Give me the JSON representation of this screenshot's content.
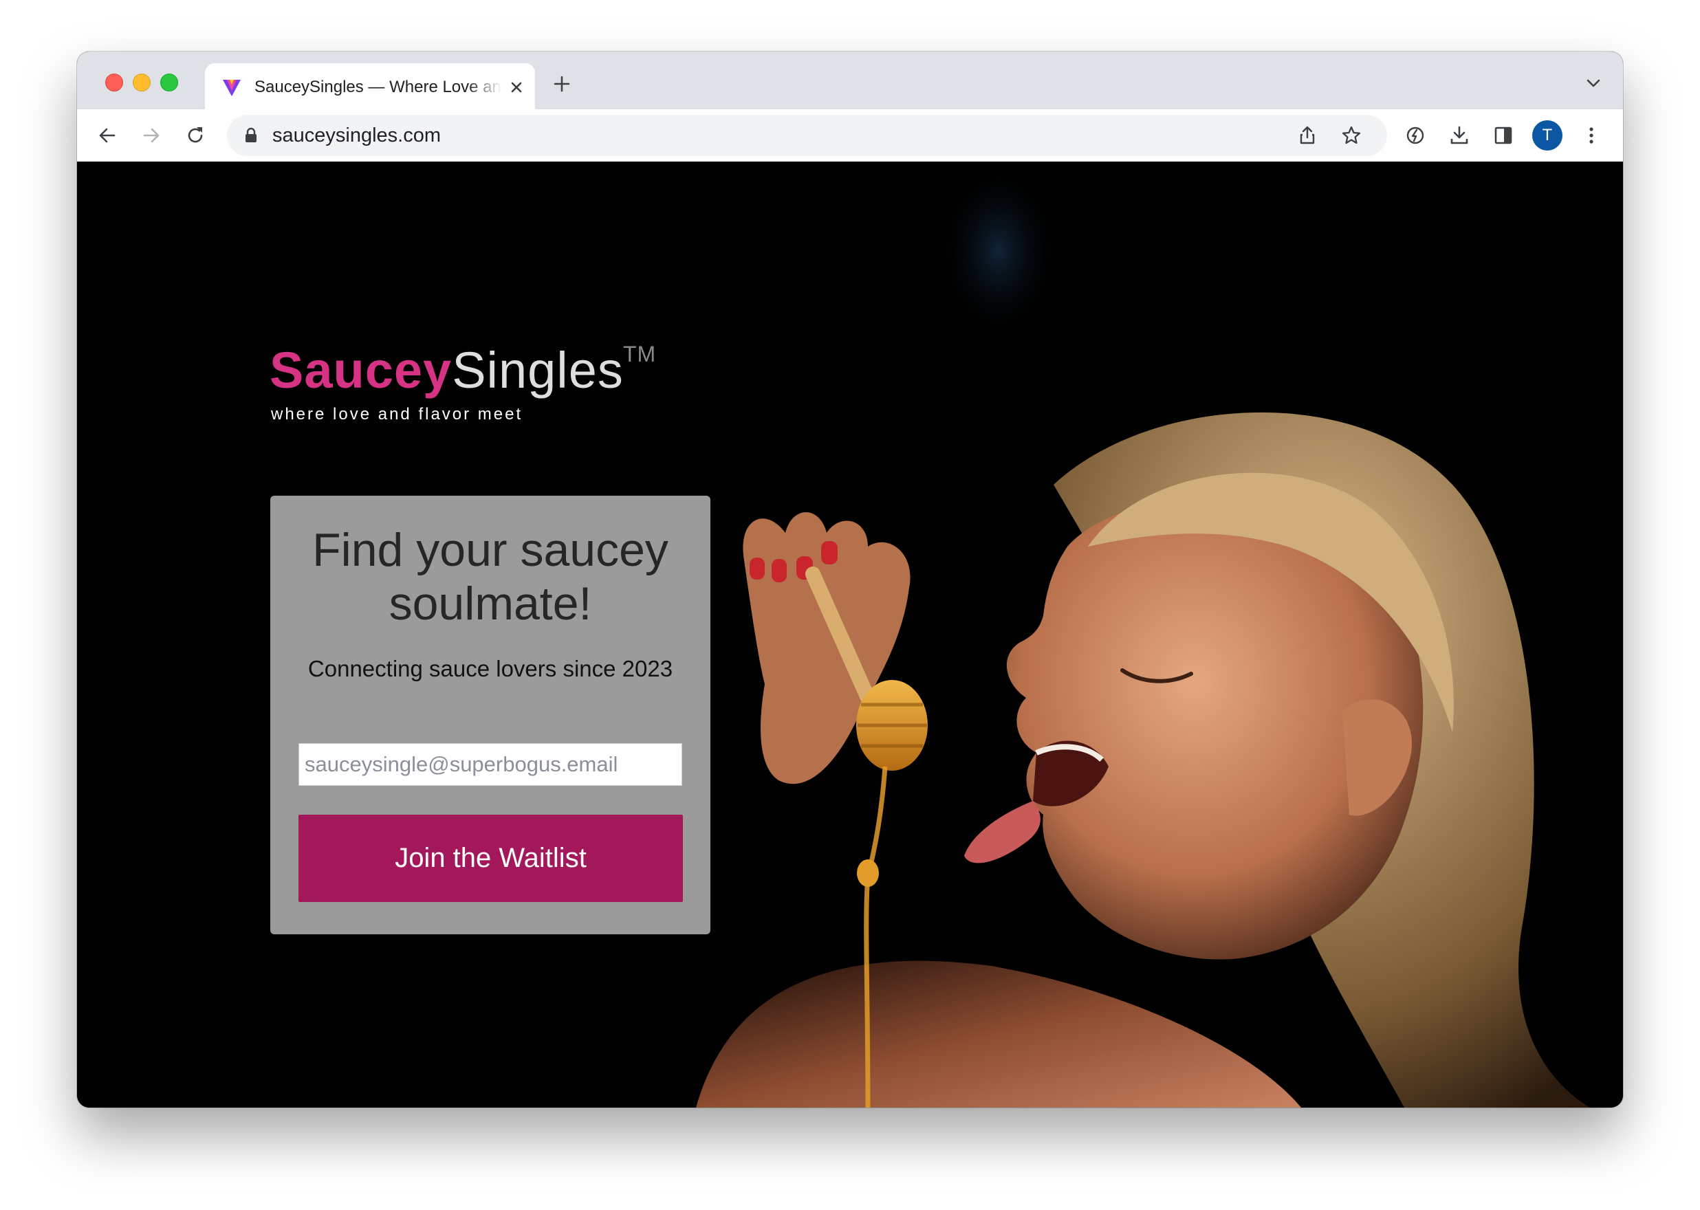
{
  "browser": {
    "tab_title": "SauceySingles — Where Love and Flavor Meet",
    "url": "sauceysingles.com",
    "avatar_initial": "T"
  },
  "hero": {
    "brand_primary": "Saucey",
    "brand_secondary": "Singles",
    "trademark": "TM",
    "tagline": "where love and flavor meet"
  },
  "signup": {
    "headline_line1": "Find your saucey",
    "headline_line2": "soulmate!",
    "subheadline": "Connecting sauce lovers since 2023",
    "email_placeholder": "sauceysingle@superbogus.email",
    "cta_label": "Join the Waitlist"
  },
  "colors": {
    "brand_pink": "#d63384",
    "cta_background": "#a3185a",
    "card_background": "#acacac",
    "avatar": "#0b57a4"
  },
  "icons": [
    "back-arrow-icon",
    "forward-arrow-icon",
    "reload-icon",
    "lock-icon",
    "share-icon",
    "bookmark-star-icon",
    "extension-icon",
    "download-icon",
    "side-panel-icon",
    "more-menu-icon"
  ]
}
